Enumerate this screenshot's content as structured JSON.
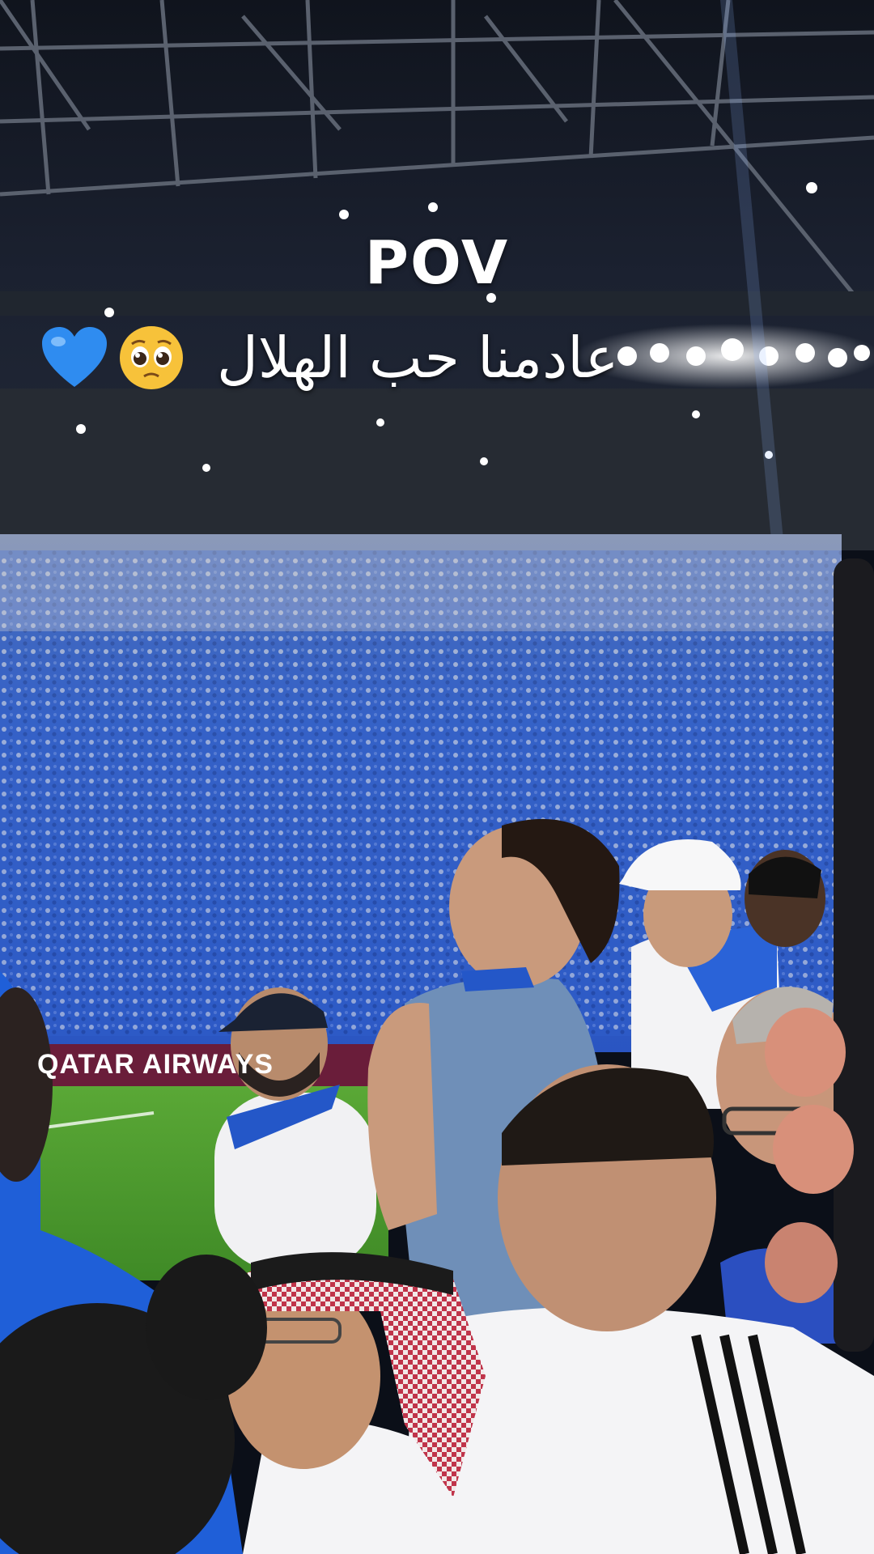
{
  "overlay": {
    "title": "POV",
    "arabic_text": "عادمنا حب الهلال",
    "emojis": [
      "blue-heart",
      "pleading-face"
    ]
  },
  "scene": {
    "board_sponsor": "QATAR AIRWAYS",
    "colors": {
      "hilal_blue": "#1e5bd6",
      "pitch_green": "#4f9a2e",
      "night_sky": "#0b0f18",
      "shemagh_red": "#c0344a"
    }
  }
}
